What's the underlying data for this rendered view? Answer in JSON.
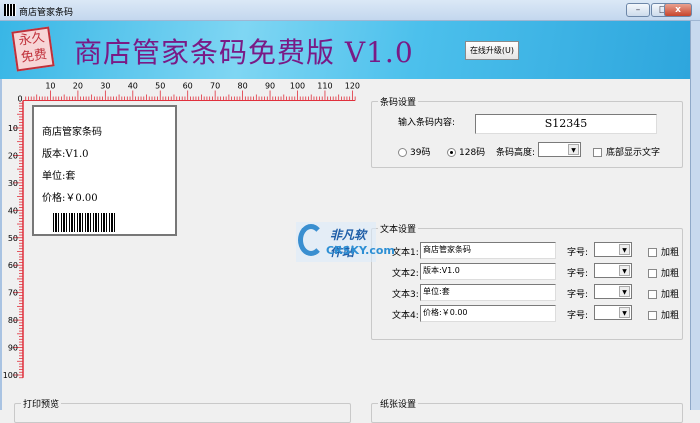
{
  "window": {
    "title": "商店管家条码",
    "min": "–",
    "max": "□",
    "close": "x"
  },
  "banner": {
    "stamp": "永久免费",
    "title": "商店管家条码免费版 V1.0",
    "upgrade_label": "在线升级(U)"
  },
  "ruler": {
    "h_labels": [
      "0",
      "10",
      "20",
      "30",
      "40",
      "50",
      "60",
      "70",
      "80",
      "90",
      "100",
      "110",
      "120"
    ],
    "v_labels": [
      "10",
      "20",
      "30",
      "40",
      "50",
      "60",
      "70",
      "80",
      "90",
      "100"
    ]
  },
  "label_preview": {
    "line1": "商店管家条码",
    "line2": "版本:V1.0",
    "line3": "单位:套",
    "line4": "价格:￥0.00"
  },
  "barcode_settings": {
    "legend": "条码设置",
    "content_label": "输入条码内容:",
    "content_value": "S12345",
    "radio39": "39码",
    "radio128": "128码",
    "height_label": "条码高度:",
    "height_value": "",
    "show_text_label": "底部显示文字"
  },
  "text_settings": {
    "legend": "文本设置",
    "rows": [
      {
        "label": "文本1:",
        "value": "商店管家条码",
        "size_label": "字号:",
        "size": "",
        "bold": "加粗"
      },
      {
        "label": "文本2:",
        "value": "版本:V1.0",
        "size_label": "字号:",
        "size": "",
        "bold": "加粗"
      },
      {
        "label": "文本3:",
        "value": "单位:套",
        "size_label": "字号:",
        "size": "",
        "bold": "加粗"
      },
      {
        "label": "文本4:",
        "value": "价格:￥0.00",
        "size_label": "字号:",
        "size": "",
        "bold": "加粗"
      }
    ]
  },
  "print_preview": {
    "legend": "打印预览"
  },
  "paper_settings": {
    "legend": "纸张设置"
  },
  "watermark": {
    "line1": "非凡软件站",
    "line2": "CRSKY.com"
  },
  "colors": {
    "ruler": "#e0303c",
    "title": "#7a1a86"
  }
}
